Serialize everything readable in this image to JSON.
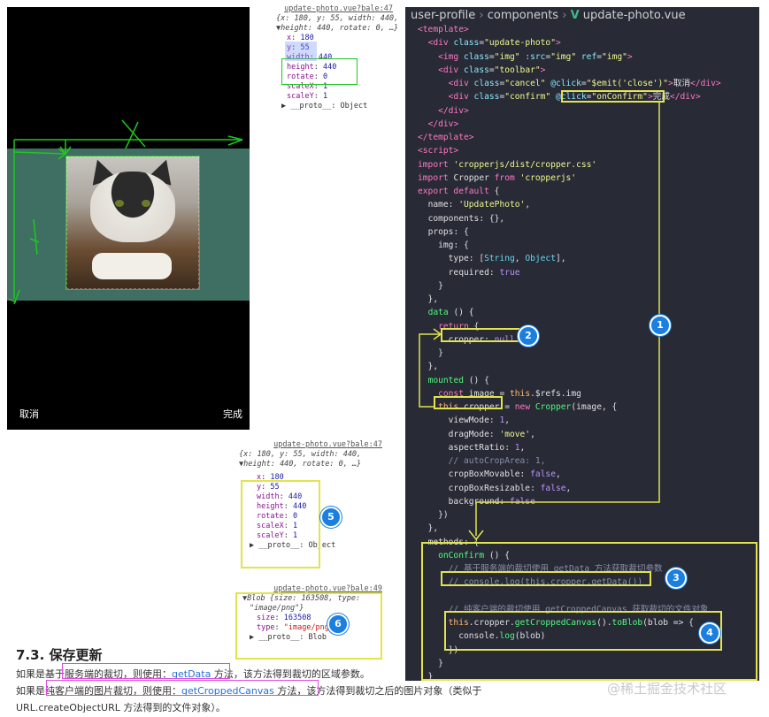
{
  "phone": {
    "cancel_label": "取消",
    "confirm_label": "完成"
  },
  "console1": {
    "source": "update-photo.vue?bale:47",
    "summary1": "{x: 180, y: 55, width: 440,",
    "summary2": "height: 440, rotate: 0, …}",
    "rows": [
      {
        "key": "x",
        "value": "180"
      },
      {
        "key": "y",
        "value": "55"
      },
      {
        "key": "width",
        "value": "440"
      },
      {
        "key": "height",
        "value": "440"
      },
      {
        "key": "rotate",
        "value": "0"
      },
      {
        "key": "scaleX",
        "value": "1"
      },
      {
        "key": "scaleY",
        "value": "1"
      }
    ],
    "proto": "__proto__: Object"
  },
  "console2": {
    "source": "update-photo.vue?bale:47",
    "summary1": "{x: 180, y: 55, width: 440,",
    "summary2": "height: 440, rotate: 0, …}",
    "rows": [
      {
        "key": "x",
        "value": "180"
      },
      {
        "key": "y",
        "value": "55"
      },
      {
        "key": "width",
        "value": "440"
      },
      {
        "key": "height",
        "value": "440"
      },
      {
        "key": "rotate",
        "value": "0"
      },
      {
        "key": "scaleX",
        "value": "1"
      },
      {
        "key": "scaleY",
        "value": "1"
      }
    ],
    "proto": "__proto__: Object"
  },
  "console3": {
    "source": "update-photo.vue?bale:49",
    "summary1": "Blob {size: 163508, type:",
    "summary2": "\"image/png\"}",
    "size_key": "size",
    "size_value": "163508",
    "type_key": "type",
    "type_value": "\"image/png\"",
    "proto": "__proto__: Blob"
  },
  "editor": {
    "breadcrumb": [
      "user-profile",
      "components",
      "update-photo.vue"
    ]
  },
  "badges": [
    "1",
    "2",
    "3",
    "4",
    "5",
    "6"
  ],
  "doc": {
    "title": "7.3. 保存更新",
    "line1_a": "如果是基于服务端的裁切，则使用：",
    "line1_link": "getData",
    "line1_b": " 方法，该方法得到裁切的区域参数。",
    "line2_a": "如果是纯客户端的图片裁切，则使用：",
    "line2_link": "getCroppedCanvas",
    "line2_b": " 方法，该方法得到裁切之后的图片对象（类似于",
    "line3": "URL.createObjectURL 方法得到的文件对象）。"
  },
  "watermark": "@稀土掘金技术社区",
  "colors": {
    "badge": "#1b7fe0",
    "highlight_yellow": "#e3e34e",
    "highlight_green": "#21c521",
    "highlight_magenta": "#e04ae0",
    "editor_bg": "#282a36"
  }
}
